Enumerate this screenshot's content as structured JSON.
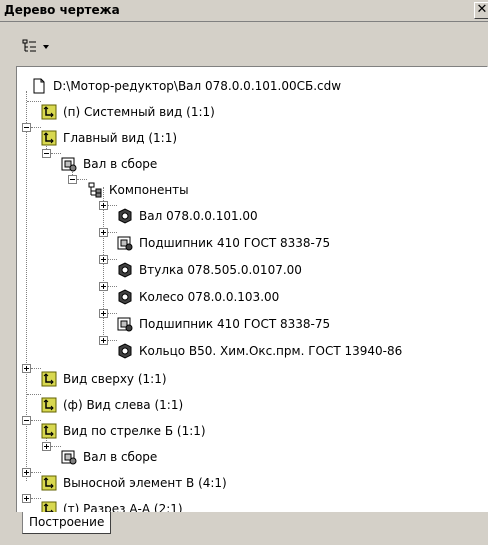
{
  "window": {
    "title": "Дерево чертежа",
    "close_glyph": "✕"
  },
  "toolbar": {
    "view_button_icon": "tree-view-icon",
    "dropdown_icon": "chevron-down-icon"
  },
  "tree": {
    "items": [
      {
        "label": "D:\\Мотор-редуктор\\Вал 078.0.0.101.00СБ.cdw",
        "icon": "document-icon"
      },
      {
        "label": "(п) Системный вид (1:1)",
        "icon": "view-icon"
      },
      {
        "label": "Главный вид (1:1)",
        "icon": "view-icon"
      },
      {
        "label": "Вал в сборе",
        "icon": "assembly-icon"
      },
      {
        "label": "Компоненты",
        "icon": "components-icon"
      },
      {
        "label": "Вал 078.0.0.101.00",
        "icon": "part-icon"
      },
      {
        "label": "Подшипник 410 ГОСТ 8338-75",
        "icon": "standard-part-icon"
      },
      {
        "label": "Втулка 078.505.0.0107.00",
        "icon": "part-icon"
      },
      {
        "label": "Колесо 078.0.0.103.00",
        "icon": "part-icon"
      },
      {
        "label": "Подшипник 410 ГОСТ 8338-75",
        "icon": "standard-part-icon"
      },
      {
        "label": "Кольцо B50. Хим.Окс.прм. ГОСТ 13940-86",
        "icon": "part-icon"
      },
      {
        "label": "Вид сверху (1:1)",
        "icon": "view-icon"
      },
      {
        "label": "(ф) Вид слева (1:1)",
        "icon": "view-icon"
      },
      {
        "label": "Вид по стрелке Б (1:1)",
        "icon": "view-icon"
      },
      {
        "label": "Вал в сборе",
        "icon": "assembly-icon"
      },
      {
        "label": "Выносной элемент В (4:1)",
        "icon": "view-icon"
      },
      {
        "label": "(т) Разрез А-А (2:1)",
        "icon": "view-icon"
      }
    ]
  },
  "tabs": {
    "active_label": "Построение"
  }
}
